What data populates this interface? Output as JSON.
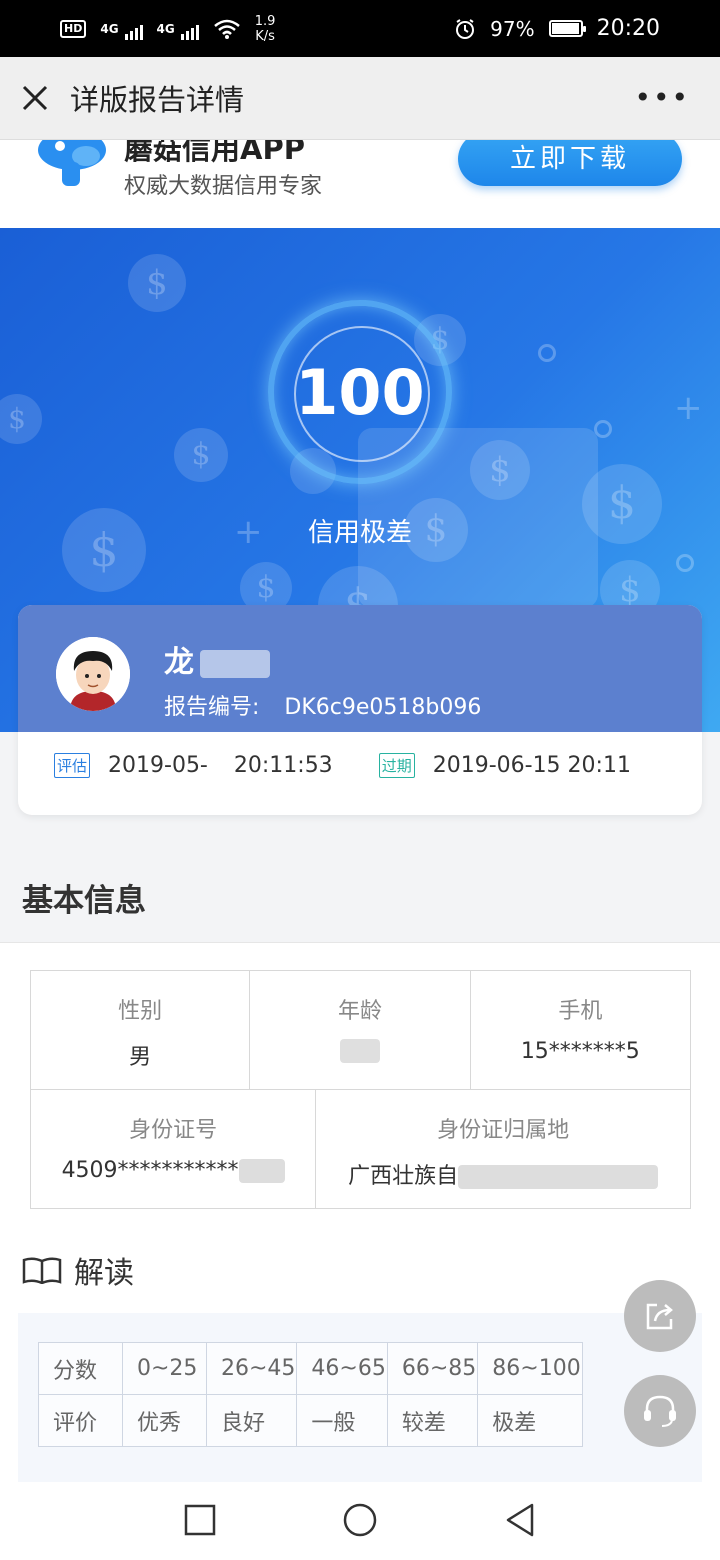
{
  "status_bar": {
    "hd": "HD",
    "signal1": "4G",
    "signal2": "4G",
    "speed_value": "1.9",
    "speed_unit": "K/s",
    "battery": "97%",
    "battery_level": 0.97,
    "time": "20:20"
  },
  "nav": {
    "title": "详版报告详情",
    "more": "•••"
  },
  "promo": {
    "app_name": "蘑菇信用APP",
    "tagline": "权威大数据信用专家",
    "download_label": "立即下载"
  },
  "hero": {
    "score": "100",
    "level": "信用极差"
  },
  "profile": {
    "name": "龙",
    "report_label": "报告编号:",
    "report_id": "DK6c9e0518b096",
    "eval_tag": "评估",
    "eval_date": "2019-05-",
    "eval_time": "20:11:53",
    "expire_tag": "过期",
    "expire_date": "2019-06-15 20:11"
  },
  "basic_info": {
    "title": "基本信息",
    "gender_label": "性别",
    "gender_value": "男",
    "age_label": "年龄",
    "age_value": "",
    "phone_label": "手机",
    "phone_value": "15*******5",
    "id_label": "身份证号",
    "id_value": "4509***********",
    "id_location_label": "身份证归属地",
    "id_location_value": "广西壮族自"
  },
  "interpret": {
    "title": "解读",
    "row1": [
      "分数",
      "0~25",
      "26~45",
      "46~65",
      "66~85",
      "86~100"
    ],
    "row2": [
      "评价",
      "优秀",
      "良好",
      "一般",
      "较差",
      "极差"
    ]
  },
  "icons": {
    "close": "close-icon",
    "more": "more-icon",
    "share": "share-icon",
    "support": "headset-icon",
    "book": "book-icon"
  },
  "colors": {
    "accent": "#1e86ea",
    "hero_start": "#1a5fd6",
    "hero_end": "#3fa9f2"
  }
}
